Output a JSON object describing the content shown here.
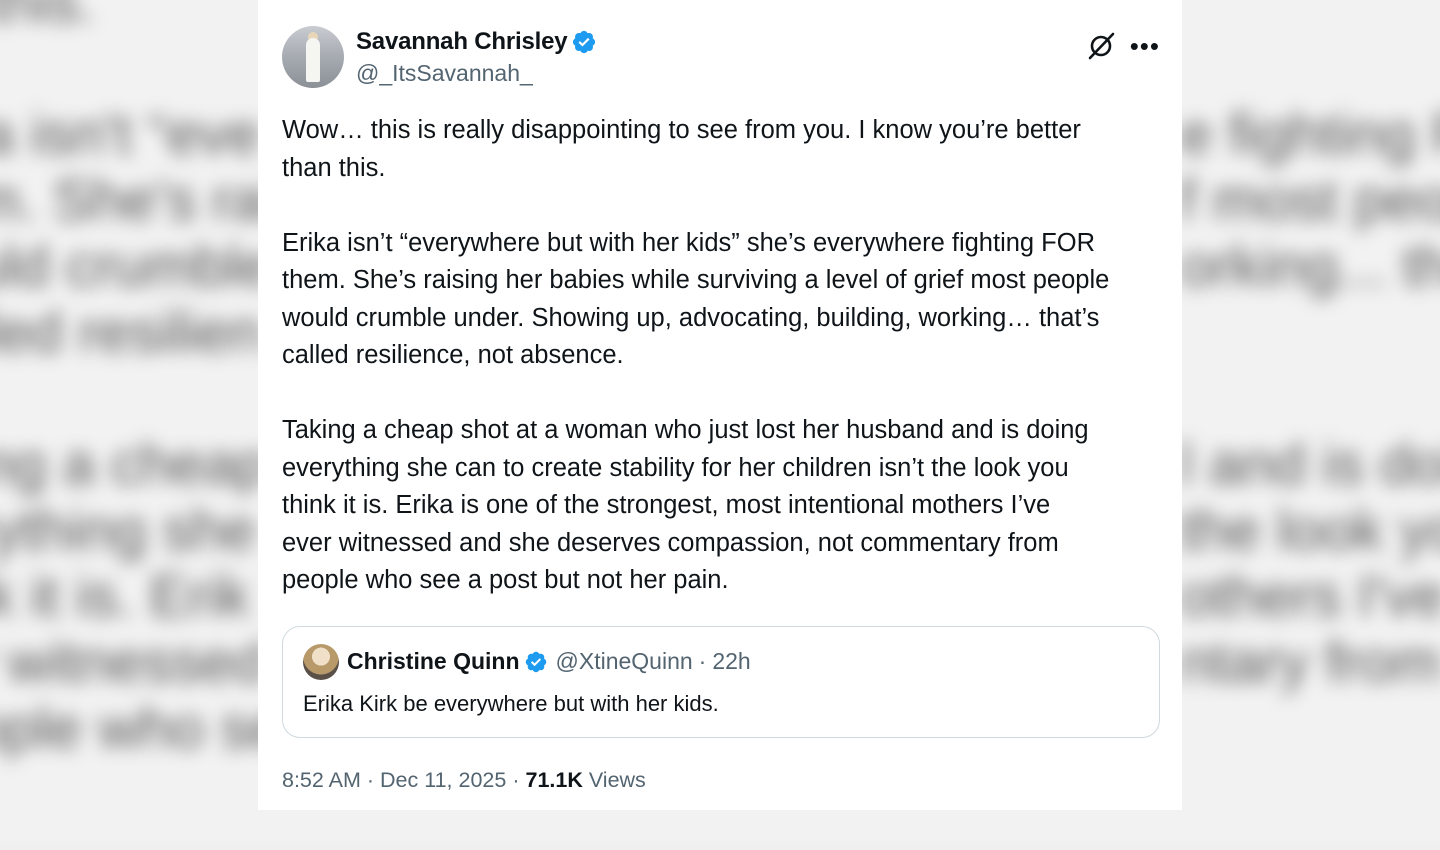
{
  "background_blur_lines": [
    "n this.",
    "",
    "ika isn't “eve",
    "em. She's rai",
    "ould crumble",
    "alled resilien",
    "",
    "king a cheap",
    "erything she",
    "ink it is. Erik",
    "er witnessed",
    "eople who se"
  ],
  "background_blur_right": [
    "",
    "",
    "e fighting FO",
    "f most peop",
    "orking... tha",
    "",
    "",
    "l and is doing",
    "the look you",
    "others I've",
    "ntary from",
    ""
  ],
  "tweet": {
    "author_name": "Savannah Chrisley",
    "author_handle": "@_ItsSavannah_",
    "paragraphs": [
      [
        "Wow… this is really disappointing to see from you. I know you’re better",
        "than this."
      ],
      [
        "Erika isn’t “everywhere but with her kids” she’s everywhere fighting FOR",
        "them. She’s raising her babies while surviving a level of grief most people",
        "would crumble under. Showing up, advocating, building, working… that’s",
        "called resilience, not absence."
      ],
      [
        "Taking a cheap shot at a woman who just lost her husband and is doing",
        "everything she can to create stability for her children isn’t the look you",
        "think it is. Erika is one of the strongest, most intentional mothers I’ve",
        "ever witnessed and she deserves compassion, not commentary from",
        "people who see a post but not her pain."
      ]
    ],
    "quote": {
      "author_name": "Christine Quinn",
      "author_handle": "@XtineQuinn",
      "separator": "·",
      "time": "22h",
      "text": "Erika Kirk be everywhere but with her kids."
    },
    "footer": {
      "time": "8:52 AM",
      "separator": "·",
      "date": "Dec 11, 2025",
      "views_count": "71.1K",
      "views_label": "Views"
    }
  },
  "icons": {
    "verified": "verified-badge-icon",
    "grok": "grok-icon",
    "more": "more-options-icon"
  },
  "colors": {
    "verified_blue": "#1d9bf0",
    "text_primary": "#0f1419",
    "text_secondary": "#536471",
    "border": "#cfd9de"
  }
}
